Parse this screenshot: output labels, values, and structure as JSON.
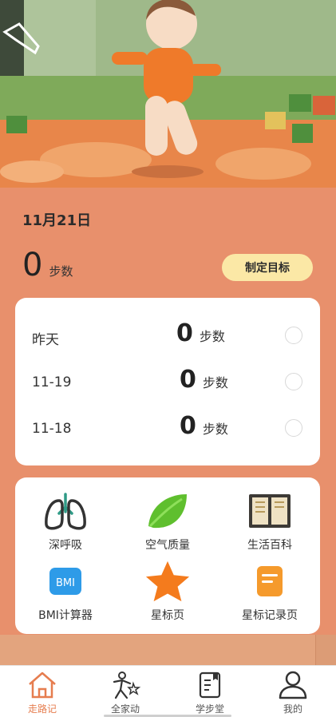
{
  "header": {
    "date": "11月21日"
  },
  "today": {
    "steps": "0",
    "unit": "步数",
    "goal_button": "制定目标"
  },
  "history": [
    {
      "label": "昨天",
      "steps": "0",
      "unit": "步数"
    },
    {
      "label": "11-19",
      "steps": "0",
      "unit": "步数"
    },
    {
      "label": "11-18",
      "steps": "0",
      "unit": "步数"
    }
  ],
  "tools": [
    {
      "label": "深呼吸",
      "icon": "lungs-icon"
    },
    {
      "label": "空气质量",
      "icon": "leaf-icon"
    },
    {
      "label": "生活百科",
      "icon": "book-icon"
    },
    {
      "label": "BMI计算器",
      "icon": "bmi-icon",
      "badge": "BMI"
    },
    {
      "label": "星标页",
      "icon": "star-icon"
    },
    {
      "label": "星标记录页",
      "icon": "notes-icon"
    }
  ],
  "tabbar": [
    {
      "label": "走路记",
      "icon": "home-icon",
      "active": true
    },
    {
      "label": "全家动",
      "icon": "family-icon",
      "active": false
    },
    {
      "label": "学步堂",
      "icon": "guide-book-icon",
      "active": false
    },
    {
      "label": "我的",
      "icon": "user-icon",
      "active": false
    }
  ],
  "colors": {
    "background": "#e8906c",
    "goal_button": "#fbe8a6",
    "accent": "#e67d4f"
  }
}
